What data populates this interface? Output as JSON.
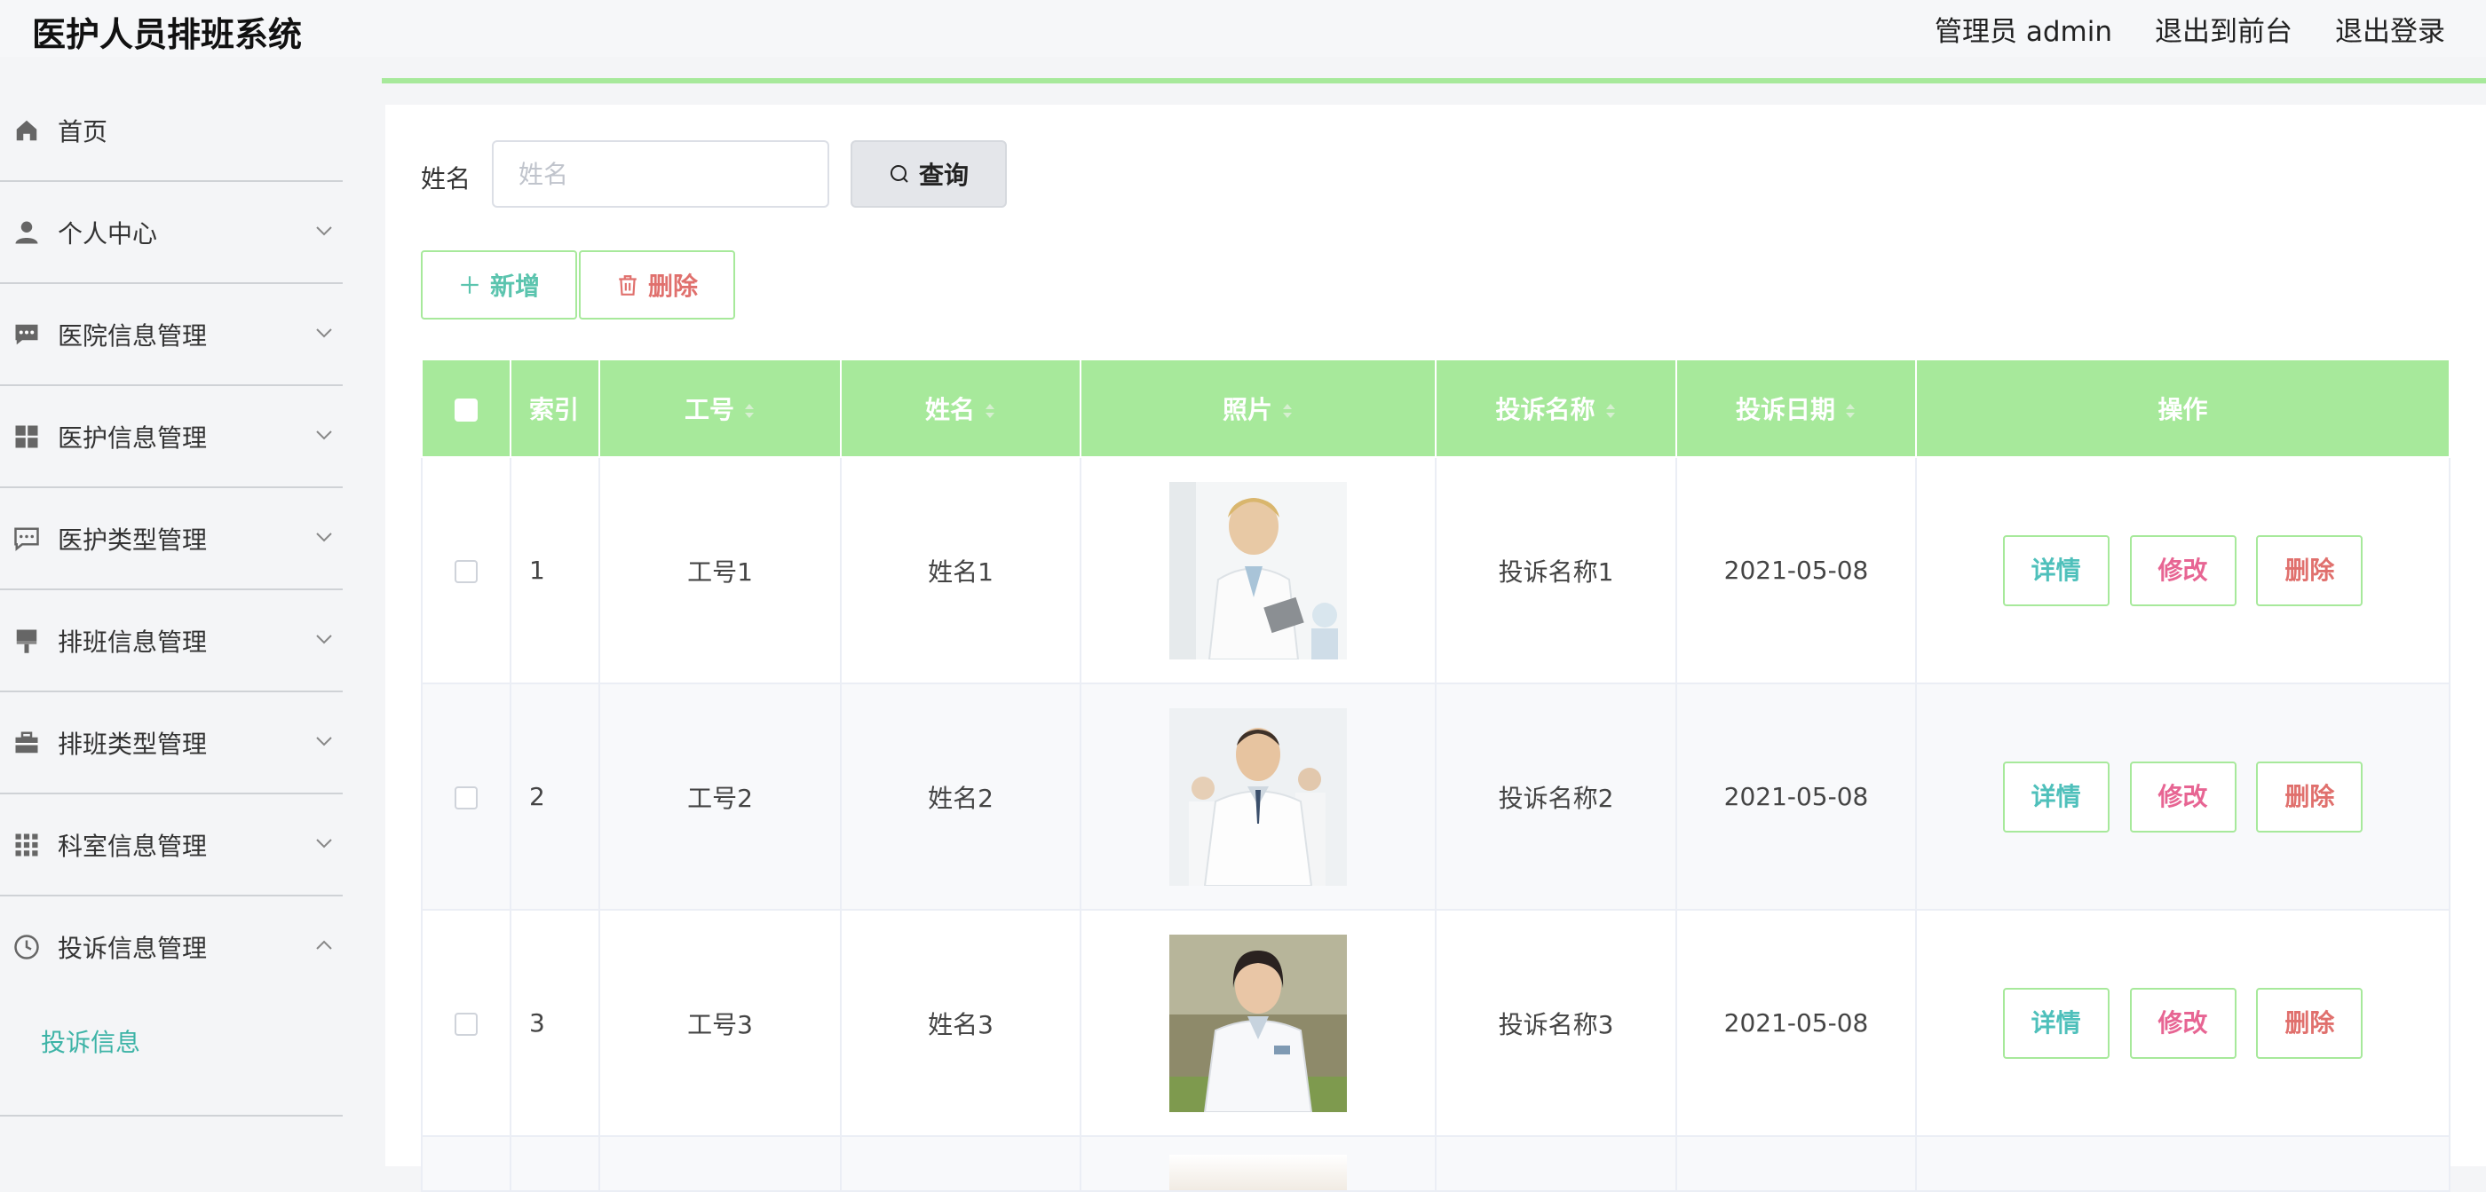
{
  "header": {
    "title": "医护人员排班系统",
    "admin_label": "管理员 admin",
    "front_label": "退出到前台",
    "logout_label": "退出登录"
  },
  "sidebar": {
    "items": [
      {
        "label": "首页",
        "icon": "home-icon"
      },
      {
        "label": "个人中心",
        "icon": "user-icon"
      },
      {
        "label": "医院信息管理",
        "icon": "chat-icon"
      },
      {
        "label": "医护信息管理",
        "icon": "grid-icon"
      },
      {
        "label": "医护类型管理",
        "icon": "message-icon"
      },
      {
        "label": "排班信息管理",
        "icon": "brush-icon"
      },
      {
        "label": "排班类型管理",
        "icon": "briefcase-icon"
      },
      {
        "label": "科室信息管理",
        "icon": "apps-icon"
      },
      {
        "label": "投诉信息管理",
        "icon": "clock-icon"
      }
    ],
    "sub_item": "投诉信息"
  },
  "search": {
    "label": "姓名",
    "placeholder": "姓名",
    "value": "",
    "query_label": "查询"
  },
  "actions": {
    "add_label": "新增",
    "delete_label": "删除"
  },
  "table": {
    "columns": [
      "索引",
      "工号",
      "姓名",
      "照片",
      "投诉名称",
      "投诉日期",
      "操作"
    ],
    "rows": [
      {
        "index": "1",
        "job_no": "工号1",
        "name": "姓名1",
        "complaint": "投诉名称1",
        "date": "2021-05-08"
      },
      {
        "index": "2",
        "job_no": "工号2",
        "name": "姓名2",
        "complaint": "投诉名称2",
        "date": "2021-05-08"
      },
      {
        "index": "3",
        "job_no": "工号3",
        "name": "姓名3",
        "complaint": "投诉名称3",
        "date": "2021-05-08"
      }
    ],
    "op_detail": "详情",
    "op_edit": "修改",
    "op_delete": "删除"
  },
  "colors": {
    "accent": "#a7e99b",
    "teal": "#4fc0bb",
    "pink": "#e76593",
    "red": "#e0706d"
  }
}
